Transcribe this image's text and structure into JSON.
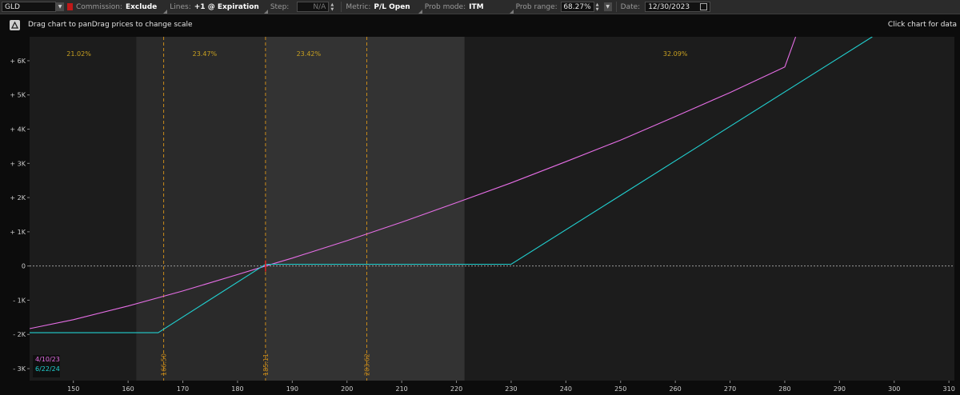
{
  "toolbar": {
    "symbol": "GLD",
    "commission_label": "Commission:",
    "commission_value": "Exclude",
    "lines_label": "Lines:",
    "lines_value": "+1 @ Expiration",
    "step_label": "Step:",
    "step_value": "N/A",
    "metric_label": "Metric:",
    "metric_value": "P/L Open",
    "prob_mode_label": "Prob mode:",
    "prob_mode_value": "ITM",
    "prob_range_label": "Prob range:",
    "prob_range_value": "68.27%",
    "date_label": "Date:",
    "date_value": "12/30/2023"
  },
  "infobar": {
    "hint": "Drag chart to panDrag prices to change scale",
    "click_hint": "Click chart for data"
  },
  "colors": {
    "series_1": "#e66ee6",
    "series_2": "#21d0d0",
    "marker_line": "#c88a1a",
    "zero_line": "#9a9a9a",
    "prob_text": "#c8a020"
  },
  "chart_data": {
    "type": "line",
    "xlim": [
      142,
      311
    ],
    "ylim": [
      -3350,
      6700
    ],
    "x_ticks": [
      150,
      160,
      170,
      180,
      190,
      200,
      210,
      220,
      230,
      240,
      250,
      260,
      270,
      280,
      290,
      300,
      310
    ],
    "y_ticks": [
      {
        "value": 6000,
        "label": "+ 6K"
      },
      {
        "value": 5000,
        "label": "+ 5K"
      },
      {
        "value": 4000,
        "label": "+ 4K"
      },
      {
        "value": 3000,
        "label": "+ 3K"
      },
      {
        "value": 2000,
        "label": "+ 2K"
      },
      {
        "value": 1000,
        "label": "+ 1K"
      },
      {
        "value": 0,
        "label": "0"
      },
      {
        "value": -1000,
        "label": "- 1K"
      },
      {
        "value": -2000,
        "label": "- 2K"
      },
      {
        "value": -3000,
        "label": "- 3K"
      }
    ],
    "zones": [
      {
        "from": 142,
        "to": 161.5,
        "shade": "dark",
        "label": "21.02%",
        "label_x": 151
      },
      {
        "from": 161.5,
        "to": 185.11,
        "shade": "mid",
        "label": "23.47%",
        "label_x": 174
      },
      {
        "from": 185.11,
        "to": 221.5,
        "shade": "light",
        "label": "23.42%",
        "label_x": 193
      },
      {
        "from": 221.5,
        "to": 311,
        "shade": "dark",
        "label": "32.09%",
        "label_x": 260
      }
    ],
    "markers": [
      {
        "x": 166.5,
        "label": "166.50"
      },
      {
        "x": 185.11,
        "label": "185.11"
      },
      {
        "x": 203.62,
        "label": "203.62"
      }
    ],
    "series": [
      {
        "name": "4/10/23",
        "x": [
          142,
          150,
          160,
          170,
          180,
          185.11,
          190,
          200,
          210,
          220,
          230,
          240,
          250,
          260,
          270,
          280,
          282
        ],
        "y": [
          -1830,
          -1570,
          -1170,
          -730,
          -250,
          0,
          230,
          740,
          1280,
          1850,
          2430,
          3050,
          3680,
          4370,
          5070,
          5820,
          6700
        ]
      },
      {
        "name": "6/22/24",
        "x": [
          142,
          165.5,
          185.11,
          230,
          296
        ],
        "y": [
          -1950,
          -1950,
          50,
          50,
          6700
        ]
      }
    ]
  }
}
